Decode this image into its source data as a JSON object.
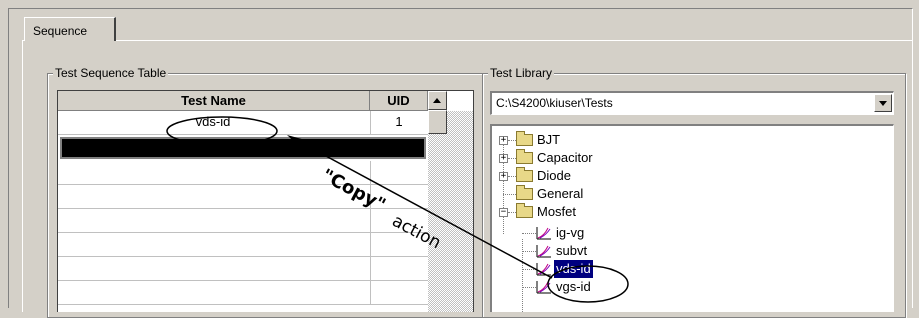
{
  "tab": {
    "label": "Sequence"
  },
  "sequence_group": {
    "label": "Test Sequence Table",
    "columns": [
      "Test Name",
      "UID"
    ],
    "rows": [
      {
        "name": "vds-id",
        "uid": "1"
      }
    ]
  },
  "library_group": {
    "label": "Test Library",
    "path": "C:\\S4200\\kiuser\\Tests",
    "tree": {
      "folders": [
        "BJT",
        "Capacitor",
        "Diode",
        "General",
        "Mosfet"
      ],
      "mosfet_children": [
        "ig-vg",
        "subvt",
        "vds-id",
        "vgs-id"
      ],
      "selected": "vds-id"
    }
  },
  "annotation": {
    "text_main": "\"Copy\"",
    "text_action": "action"
  },
  "colors": {
    "face": "#d4d0c8",
    "selection": "#000080"
  }
}
